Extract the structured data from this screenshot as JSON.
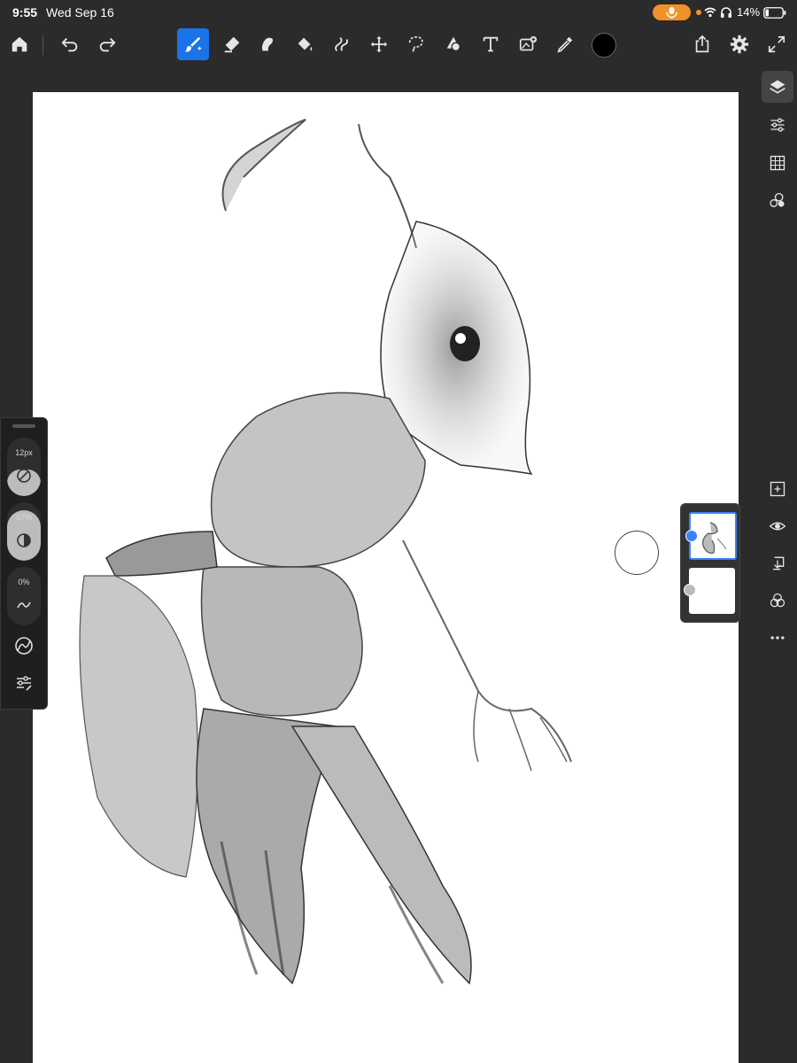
{
  "status_bar": {
    "time": "9:55",
    "date": "Wed Sep 16",
    "battery": "14%",
    "icons": [
      "mic-icon",
      "wifi-icon",
      "headphones-icon",
      "battery-icon"
    ]
  },
  "toolbar": {
    "tools": [
      "home-icon",
      "undo-icon",
      "redo-icon",
      "brush-icon",
      "eraser-icon",
      "smudge-icon",
      "fill-icon",
      "liquify-icon",
      "transform-icon",
      "lasso-icon",
      "shape-icon",
      "text-icon",
      "image-icon",
      "eyedropper-icon"
    ],
    "active_tool": "brush-icon",
    "current_color": "#000000",
    "right_icons": [
      "share-icon",
      "settings-icon",
      "fullscreen-icon"
    ]
  },
  "brush_panel": {
    "size_label": "12px",
    "opacity_label": "87%",
    "flow_label": "0%",
    "size_fill": 0.45,
    "opacity_fill": 0.87
  },
  "right_panel": {
    "top_icons": [
      "layers-icon",
      "adjustments-icon",
      "grid-icon",
      "shapes-icon"
    ],
    "bottom_icons": [
      "add-layer-icon",
      "visibility-icon",
      "merge-down-icon",
      "blend-mode-icon",
      "more-icon"
    ]
  },
  "layers": [
    {
      "selected": true
    },
    {
      "selected": false
    }
  ],
  "colors": {
    "accent": "#1a73e8",
    "background": "#2b2b2b",
    "mic_pill": "#f0922a"
  }
}
